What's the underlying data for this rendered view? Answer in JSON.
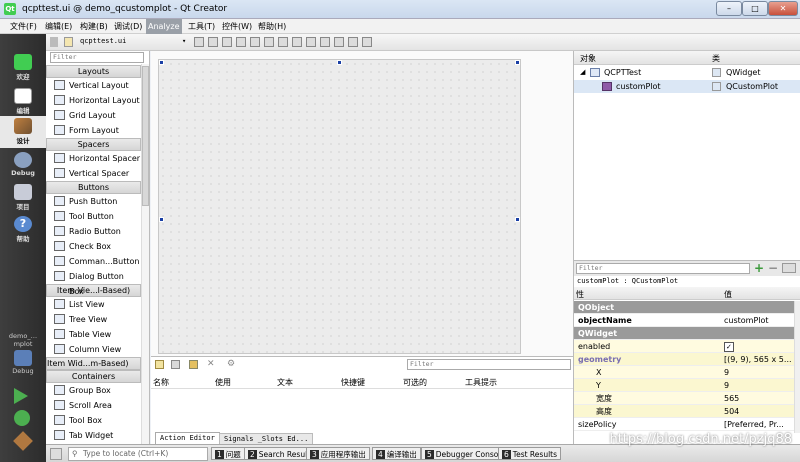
{
  "window": {
    "title": "qcpttest.ui @ demo_qcustomplot - Qt Creator",
    "minimize": "–",
    "maximize": "□",
    "close": "✕"
  },
  "menu": [
    "文件(F)",
    "编辑(E)",
    "构建(B)",
    "调试(D)",
    "Analyze",
    "工具(T)",
    "控件(W)",
    "帮助(H)"
  ],
  "menu_active": "Analyze",
  "modes": [
    {
      "label": "欢迎",
      "icon": "qt-logo-icon"
    },
    {
      "label": "编辑",
      "icon": "edit-document-icon"
    },
    {
      "label": "设计",
      "icon": "design-pencil-icon",
      "selected": true
    },
    {
      "label": "Debug",
      "icon": "debug-bug-icon"
    },
    {
      "label": "项目",
      "icon": "project-wrench-icon"
    },
    {
      "label": "帮助",
      "icon": "help-icon"
    }
  ],
  "kit": {
    "project": "demo_…mplot",
    "mode": "Debug"
  },
  "toolbar": {
    "file": "qcpttest.ui"
  },
  "widgetbox": {
    "filter_placeholder": "Filter",
    "groups": [
      {
        "title": "Layouts",
        "items": [
          "Vertical Layout",
          "Horizontal Layout",
          "Grid Layout",
          "Form Layout"
        ]
      },
      {
        "title": "Spacers",
        "items": [
          "Horizontal Spacer",
          "Vertical Spacer"
        ]
      },
      {
        "title": "Buttons",
        "items": [
          "Push Button",
          "Tool Button",
          "Radio Button",
          "Check Box",
          "Comman...Button",
          "Dialog Button Box"
        ]
      },
      {
        "title": "Item Vie...l-Based)",
        "items": [
          "List View",
          "Tree View",
          "Table View",
          "Column View"
        ]
      },
      {
        "title": "Item Wid...m-Based)",
        "items": []
      },
      {
        "title": "Containers",
        "items": [
          "Group Box",
          "Scroll Area",
          "Tool Box",
          "Tab Widget"
        ]
      }
    ]
  },
  "action_editor": {
    "filter_placeholder": "Filter",
    "columns": [
      "名称",
      "使用",
      "文本",
      "快捷键",
      "可选的",
      "工具提示"
    ],
    "tabs": [
      "Action Editor",
      "Signals _Slots Ed..."
    ]
  },
  "object_inspector": {
    "col_object": "对象",
    "col_class": "类",
    "rows": [
      {
        "object": "QCPTTest",
        "class": "QWidget"
      },
      {
        "object": "customPlot",
        "class": "QCustomPlot"
      }
    ]
  },
  "property_editor": {
    "filter_placeholder": "Filter",
    "header_line": "customPlot : QCustomPlot",
    "col_prop": "性",
    "col_value": "值",
    "rows": [
      {
        "type": "section",
        "name": "QObject"
      },
      {
        "name": "objectName",
        "value": "customPlot",
        "bold": true
      },
      {
        "type": "section",
        "name": "QWidget"
      },
      {
        "name": "enabled",
        "value": "✓"
      },
      {
        "name": "geometry",
        "value": "[(9, 9), 565 x 5...",
        "expand": true
      },
      {
        "name": "X",
        "value": "9",
        "indent": true
      },
      {
        "name": "Y",
        "value": "9",
        "indent": true
      },
      {
        "name": "宽度",
        "value": "565",
        "indent": true
      },
      {
        "name": "高度",
        "value": "504",
        "indent": true
      },
      {
        "name": "sizePolicy",
        "value": "[Preferred, Pr..."
      }
    ]
  },
  "status": {
    "locate_placeholder": "Type to locate (Ctrl+K)",
    "panes": [
      {
        "n": "1",
        "label": "问题"
      },
      {
        "n": "2",
        "label": "Search Results"
      },
      {
        "n": "3",
        "label": "应用程序输出"
      },
      {
        "n": "4",
        "label": "编译输出"
      },
      {
        "n": "5",
        "label": "Debugger Console"
      },
      {
        "n": "6",
        "label": "Test Results"
      }
    ]
  },
  "watermark": "https://blog.csdn.net/pzjq88"
}
